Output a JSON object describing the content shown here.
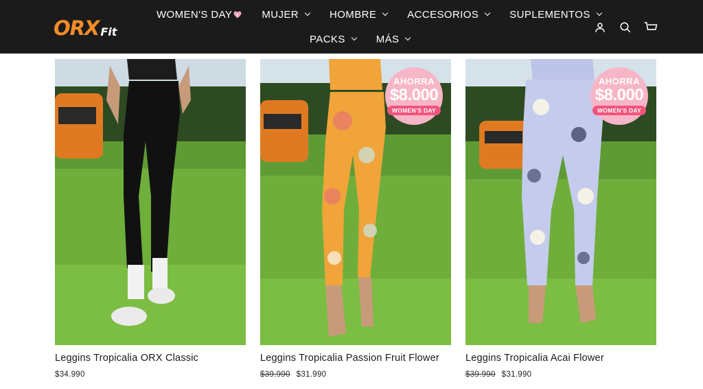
{
  "brand": {
    "logo_main": "ORX",
    "logo_sub": "Fit",
    "accent": "#f28c28"
  },
  "nav": {
    "row1": [
      {
        "label": "WOMEN'S DAY",
        "dropdown": false,
        "heart": true
      },
      {
        "label": "MUJER",
        "dropdown": true
      },
      {
        "label": "HOMBRE",
        "dropdown": true
      },
      {
        "label": "ACCESORIOS",
        "dropdown": true
      },
      {
        "label": "SUPLEMENTOS",
        "dropdown": true
      }
    ],
    "row2": [
      {
        "label": "PACKS",
        "dropdown": true
      },
      {
        "label": "MÁS",
        "dropdown": true
      }
    ]
  },
  "header_icons": [
    "user-icon",
    "search-icon",
    "cart-icon"
  ],
  "products": [
    {
      "title": "Leggins Tropicalia ORX Classic",
      "old_price": "",
      "price": "$34.990",
      "badge": null,
      "pattern": "black"
    },
    {
      "title": "Leggins Tropicalia Passion Fruit Flower",
      "old_price": "$39.990",
      "price": "$31.990",
      "badge": {
        "top": "AHORRA",
        "amount": "$8.000",
        "tag": "WOMEN'S DAY"
      },
      "pattern": "orange-floral"
    },
    {
      "title": "Leggins Tropicalia Acai Flower",
      "old_price": "$39.990",
      "price": "$31.990",
      "badge": {
        "top": "AHORRA",
        "amount": "$8.000",
        "tag": "WOMEN'S DAY"
      },
      "pattern": "blue-floral"
    }
  ]
}
